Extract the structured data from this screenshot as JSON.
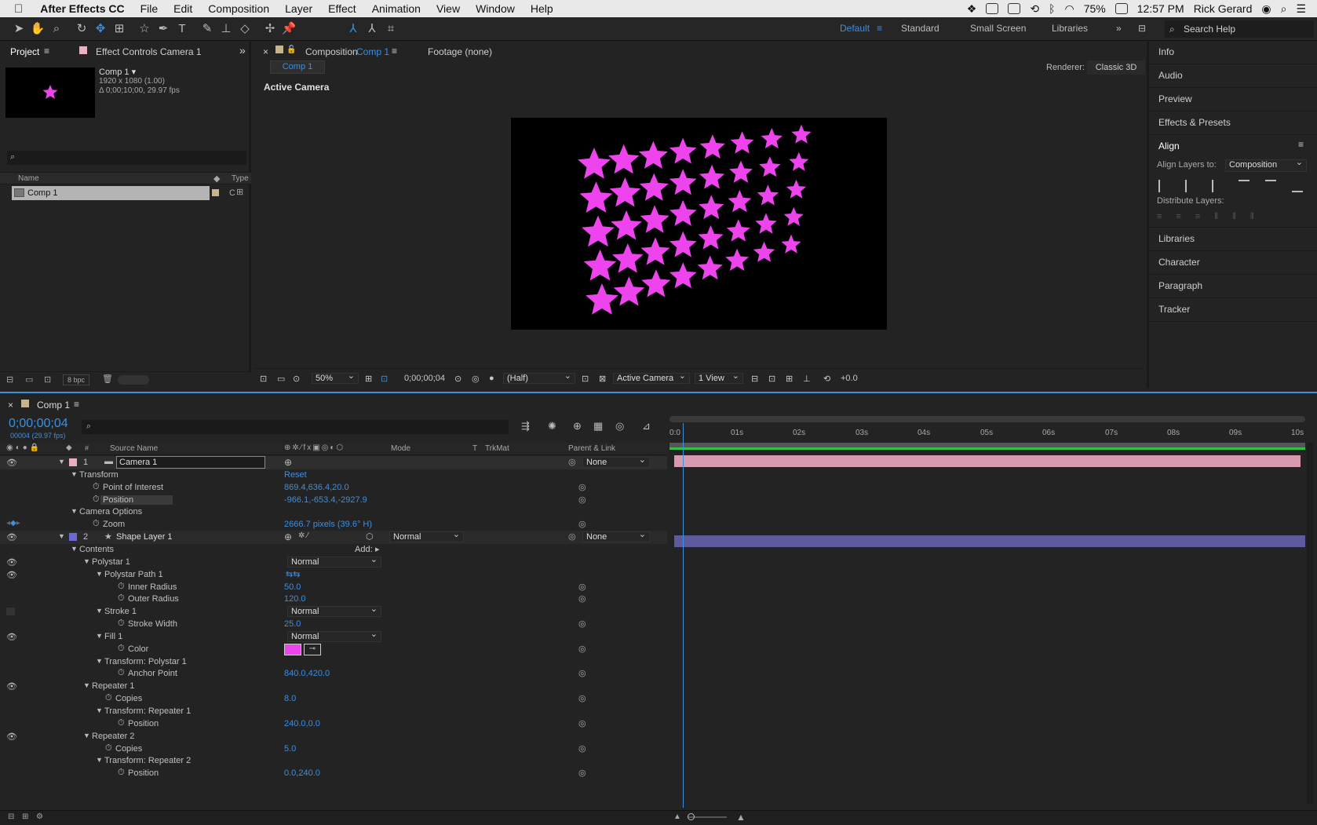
{
  "menubar": {
    "app_name": "After Effects CC",
    "items": [
      "File",
      "Edit",
      "Composition",
      "Layer",
      "Effect",
      "Animation",
      "View",
      "Window",
      "Help"
    ],
    "battery": "75%",
    "clock": "12:57 PM",
    "user": "Rick Gerard"
  },
  "workspaces": {
    "items": [
      "Default",
      "Standard",
      "Small Screen",
      "Libraries"
    ],
    "active": "Default",
    "search_label": "Search Help"
  },
  "project": {
    "tab_project": "Project",
    "tab_effect_controls": "Effect Controls Camera 1",
    "comp_name": "Comp 1 ▾",
    "comp_size": "1920 x 1080 (1.00)",
    "comp_duration": "Δ 0;00;10;00, 29.97 fps",
    "col_name": "Name",
    "col_type": "Type",
    "item_name": "Comp 1",
    "item_type": "C",
    "bpc": "8 bpc"
  },
  "viewer": {
    "tab_prefix": "Composition",
    "tab_comp": "Comp 1",
    "tab_footage": "Footage (none)",
    "sub_tab": "Comp 1",
    "renderer_label": "Renderer:",
    "renderer_value": "Classic 3D",
    "view_label": "Active Camera",
    "zoom": "50%",
    "timecode": "0;00;00;04",
    "resolution": "(Half)",
    "camera": "Active Camera",
    "views": "1 View",
    "exposure": "+0.0",
    "star_color": "#ee44ee"
  },
  "right_panel": {
    "items_top": [
      "Info",
      "Audio",
      "Preview",
      "Effects & Presets"
    ],
    "align_title": "Align",
    "align_to_label": "Align Layers to:",
    "align_to_value": "Composition",
    "distribute_label": "Distribute Layers:",
    "items_bottom": [
      "Libraries",
      "Character",
      "Paragraph",
      "Tracker"
    ]
  },
  "timeline": {
    "tab": "Comp 1",
    "timecode": "0;00;00;04",
    "frame_info": "00004 (29.97 fps)",
    "col_source": "Source Name",
    "col_mode": "Mode",
    "col_t": "T",
    "col_trkmat": "TrkMat",
    "col_parent": "Parent & Link",
    "ruler": [
      "0:0",
      "01s",
      "02s",
      "03s",
      "04s",
      "05s",
      "06s",
      "07s",
      "08s",
      "09s",
      "10s"
    ],
    "rows": [
      {
        "label": "1",
        "name": "Camera 1",
        "parent": "None"
      },
      {
        "label": "Transform",
        "value": "Reset"
      },
      {
        "label": "Point of Interest",
        "value": "869.4,636.4,20.0"
      },
      {
        "label": "Position",
        "value": "-966.1,-653.4,-2927.9"
      },
      {
        "label": "Camera Options"
      },
      {
        "label": "Zoom",
        "value": "2666.7 pixels (39.6° H)"
      },
      {
        "label": "2",
        "name": "Shape Layer 1",
        "mode": "Normal",
        "parent": "None"
      },
      {
        "label": "Contents",
        "value": "Add:"
      },
      {
        "label": "Polystar 1",
        "value": "Normal"
      },
      {
        "label": "Polystar Path 1"
      },
      {
        "label": "Inner Radius",
        "value": "50.0"
      },
      {
        "label": "Outer Radius",
        "value": "120.0"
      },
      {
        "label": "Stroke 1",
        "value": "Normal"
      },
      {
        "label": "Stroke Width",
        "value": "25.0"
      },
      {
        "label": "Fill 1",
        "value": "Normal"
      },
      {
        "label": "Color"
      },
      {
        "label": "Transform: Polystar 1"
      },
      {
        "label": "Anchor Point",
        "value": "840.0,420.0"
      },
      {
        "label": "Repeater 1"
      },
      {
        "label": "Copies",
        "value": "8.0"
      },
      {
        "label": "Transform: Repeater 1"
      },
      {
        "label": "Position",
        "value": "240.0,0.0"
      },
      {
        "label": "Repeater 2"
      },
      {
        "label": "Copies",
        "value": "5.0"
      },
      {
        "label": "Transform: Repeater 2"
      },
      {
        "label": "Position",
        "value": "0.0,240.0"
      }
    ],
    "camera_bar_color": "#d89ab0",
    "shape_bar_color": "#5c5c9c",
    "fill_color": "#ee44ee"
  }
}
